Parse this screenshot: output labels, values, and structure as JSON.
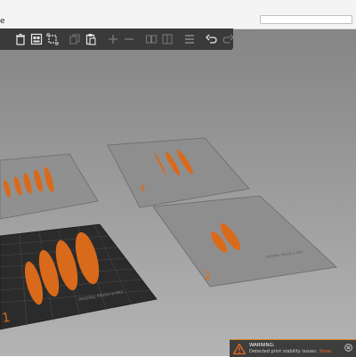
{
  "window": {
    "title": "e"
  },
  "search": {
    "value": ""
  },
  "toolbar": {
    "buttons": [
      {
        "name": "delete-icon",
        "enabled": true
      },
      {
        "name": "arrange-icon",
        "enabled": true
      },
      {
        "name": "arrange-selection-icon",
        "enabled": true
      },
      {
        "name": "copy-icon",
        "enabled": false
      },
      {
        "name": "paste-icon",
        "enabled": true
      },
      {
        "name": "add-instance-icon",
        "enabled": false
      },
      {
        "name": "remove-instance-icon",
        "enabled": false
      },
      {
        "name": "split-objects-icon",
        "enabled": false
      },
      {
        "name": "split-parts-icon",
        "enabled": false
      },
      {
        "name": "layers-icon",
        "enabled": false
      },
      {
        "name": "undo-icon",
        "enabled": true
      },
      {
        "name": "redo-icon",
        "enabled": false
      }
    ]
  },
  "plates": [
    {
      "number": "1",
      "active": true,
      "label": "ORIGINAL PRUSA i3 MK3"
    },
    {
      "number": "2",
      "active": false,
      "label": "ORIGINAL PRUSA i3 MK3"
    },
    {
      "number": "4",
      "active": false,
      "label": ""
    },
    {
      "number": "",
      "active": false,
      "label": ""
    }
  ],
  "notification": {
    "title": "WARNING:",
    "message": "Detected print stability issues:",
    "link": "Show"
  },
  "colors": {
    "accent": "#ed6b21",
    "part": "#d96a1b",
    "toolbar_bg": "#3a3a3a",
    "bed_active": "#2b2b2b",
    "bed_inactive": "#8c8c8c"
  }
}
